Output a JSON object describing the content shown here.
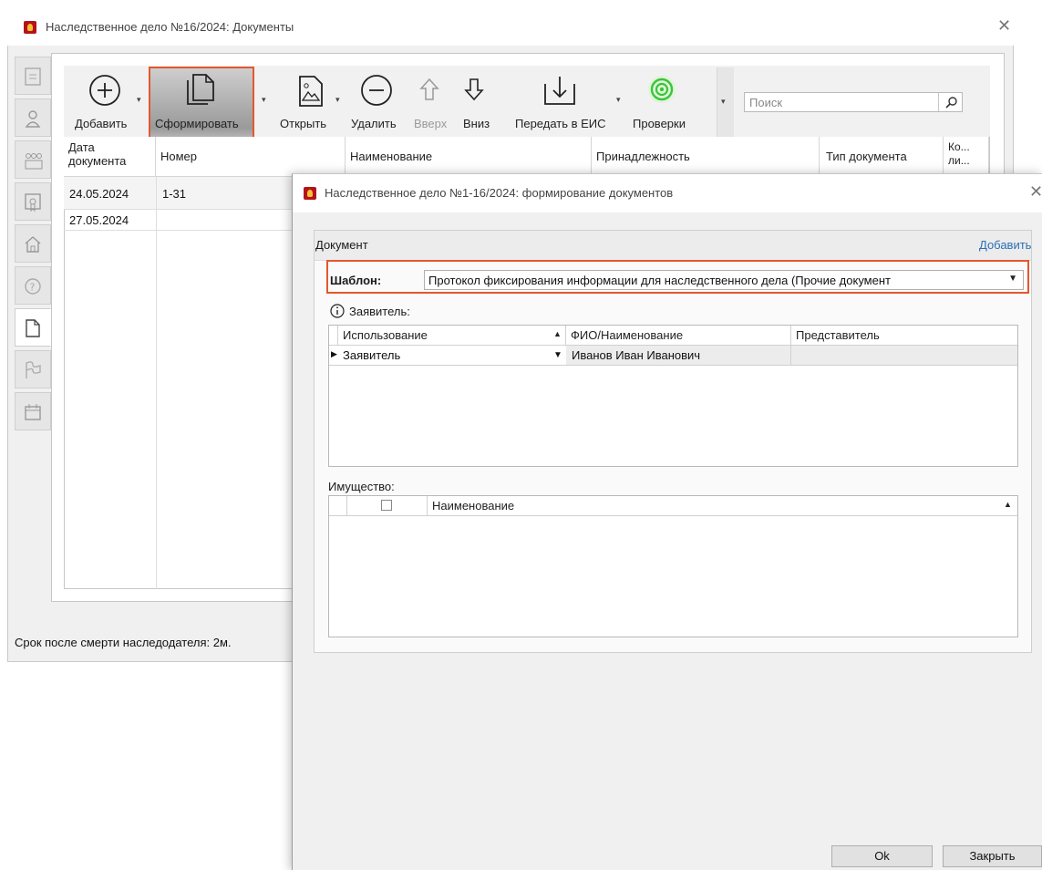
{
  "main_window": {
    "title": "Наследственное дело №16/2024: Документы",
    "toolbar": {
      "add": "Добавить",
      "generate": "Сформировать",
      "open": "Открыть",
      "delete": "Удалить",
      "up": "Вверх",
      "down": "Вниз",
      "send_eis": "Передать в ЕИС",
      "checks": "Проверки"
    },
    "search_placeholder": "Поиск",
    "columns": [
      "Дата документа",
      "Номер",
      "Наименование",
      "Принадлежность",
      "Тип документа",
      "Ко... ли..."
    ],
    "rows": [
      {
        "date": "24.05.2024",
        "number": "1-31"
      },
      {
        "date": "27.05.2024",
        "number": ""
      }
    ],
    "status": "Срок после смерти наследодателя: 2м."
  },
  "dialog": {
    "title": "Наследственное дело №1-16/2024: формирование документов",
    "panel_title": "Документ",
    "add_link": "Добавить",
    "template_label": "Шаблон:",
    "template_value": "Протокол фиксирования информации для наследственного дела (Прочие документ",
    "applicant_label": "Заявитель:",
    "applicant_columns": [
      "Использование",
      "ФИО/Наименование",
      "Представитель"
    ],
    "applicant_rows": [
      {
        "usage": "Заявитель",
        "name": "Иванов Иван Иванович",
        "representative": ""
      }
    ],
    "property_label": "Имущество:",
    "property_columns": [
      "Наименование"
    ],
    "ok": "Ok",
    "close": "Закрыть"
  },
  "colors": {
    "highlight": "#e4572e",
    "brand": "#b5121b",
    "check_green": "#3cc43c"
  }
}
